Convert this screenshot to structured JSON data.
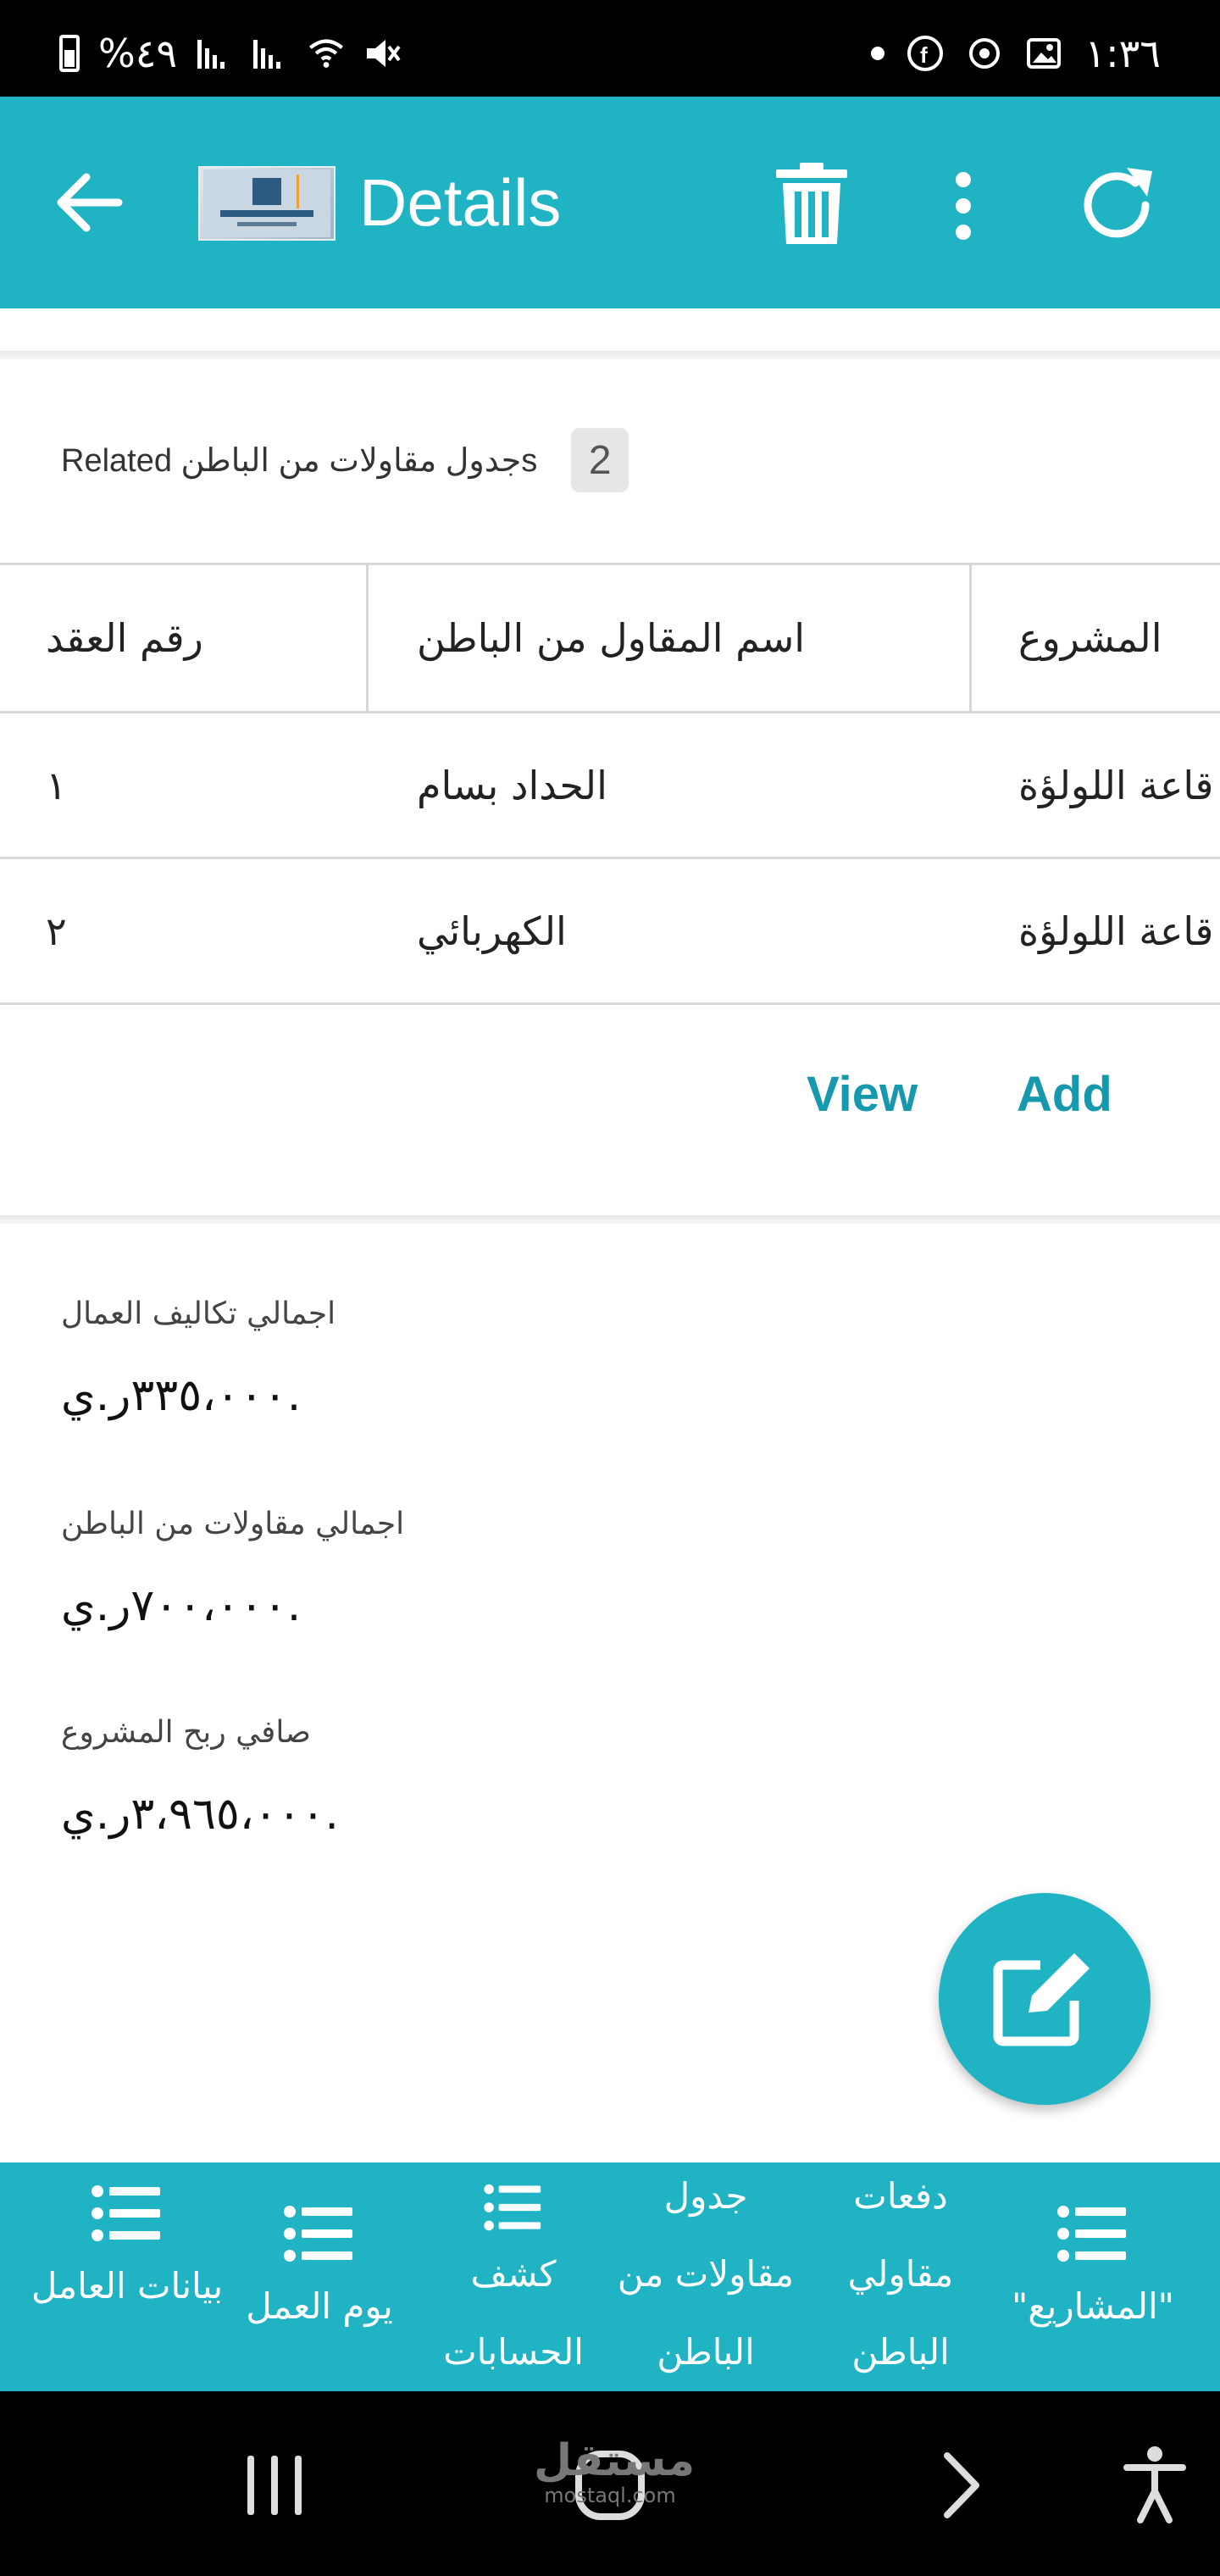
{
  "status_bar": {
    "battery_text": "%٤٩",
    "time": "١:٣٦"
  },
  "app_bar": {
    "title": "Details"
  },
  "related": {
    "label": "Related جدول مقاولات من الباطنs",
    "count": "2"
  },
  "table": {
    "headers": [
      "رقم العقد",
      "اسم المقاول من الباطن",
      "المشروع"
    ],
    "rows": [
      [
        "١",
        "الحداد بسام",
        "قاعة اللولؤة"
      ],
      [
        "٢",
        "الكهربائي",
        "قاعة اللولؤة"
      ]
    ]
  },
  "actions": {
    "view_label": "View",
    "add_label": "Add"
  },
  "summary": [
    {
      "label": "اجمالي تكاليف العمال",
      "value": "٣٣٥،٠٠٠ر.ي."
    },
    {
      "label": "اجمالي مقاولات من الباطن",
      "value": "٧٠٠،٠٠٠ر.ي."
    },
    {
      "label": "صافي ربح المشروع",
      "value": "٣،٩٦٥،٠٠٠ر.ي."
    }
  ],
  "bottom_nav": {
    "items": [
      {
        "label": "بيانات العامل",
        "icon": "list-icon"
      },
      {
        "label": "يوم العمل",
        "icon": "list-icon"
      },
      {
        "label": "كشف الحسابات",
        "icon": "list-icon"
      },
      {
        "label": "جدول مقاولات من الباطن",
        "icon": "medical-bag-icon"
      },
      {
        "label": "دفعات مقاولي الباطن",
        "icon": "payment-chat-icon"
      },
      {
        "label": "\"المشاريع\"",
        "icon": "list-icon"
      }
    ]
  },
  "watermark": {
    "text": "مستقل",
    "sub": "mostaql.com"
  },
  "colors": {
    "primary": "#1fb3c4",
    "link": "#1799ad"
  }
}
